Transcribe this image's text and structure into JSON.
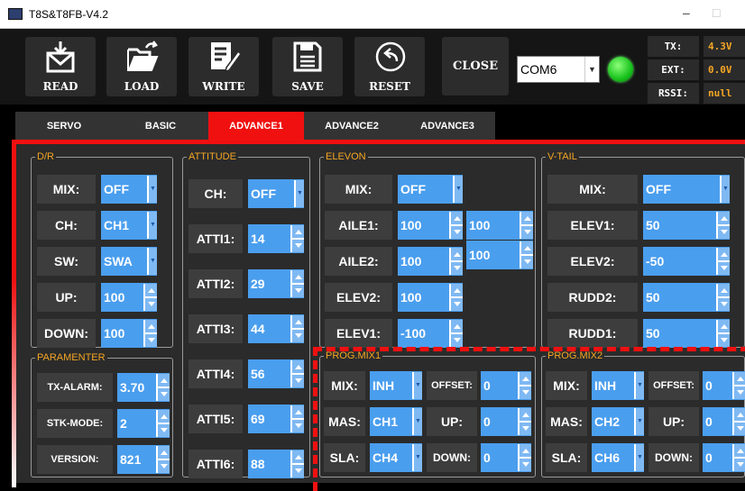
{
  "window": {
    "title": "T8S&T8FB-V4.2",
    "minimize": "–",
    "maximize": "□"
  },
  "toolbar": {
    "read": "READ",
    "load": "LOAD",
    "write": "WRITE",
    "save": "SAVE",
    "reset": "RESET",
    "close": "CLOSE",
    "port": "COM6",
    "connected_color": "#18c21c"
  },
  "status": {
    "tx_label": "TX:",
    "tx_value": "4.3V",
    "ext_label": "EXT:",
    "ext_value": "0.0V",
    "rssi_label": "RSSI:",
    "rssi_value": "null"
  },
  "tabs": [
    "SERVO",
    "BASIC",
    "ADVANCE1",
    "ADVANCE2",
    "ADVANCE3"
  ],
  "dr": {
    "title": "D/R",
    "mix_l": "MIX:",
    "mix": "OFF",
    "ch_l": "CH:",
    "ch": "CH1",
    "sw_l": "SW:",
    "sw": "SWA",
    "up_l": "UP:",
    "up": "100",
    "down_l": "DOWN:",
    "down": "100"
  },
  "param": {
    "title": "PARAMENTER",
    "txalarm_l": "TX-ALARM:",
    "txalarm": "3.70",
    "stk_l": "STK-MODE:",
    "stk": "2",
    "ver_l": "VERSION:",
    "ver": "821"
  },
  "atti": {
    "title": "ATTITUDE",
    "ch_l": "CH:",
    "ch": "OFF",
    "a1_l": "ATTI1:",
    "a1": "14",
    "a2_l": "ATTI2:",
    "a2": "29",
    "a3_l": "ATTI3:",
    "a3": "44",
    "a4_l": "ATTI4:",
    "a4": "56",
    "a5_l": "ATTI5:",
    "a5": "69",
    "a6_l": "ATTI6:",
    "a6": "88"
  },
  "elevon": {
    "title": "ELEVON",
    "mix_l": "MIX:",
    "mix": "OFF",
    "aile1_l": "AILE1:",
    "aile1": "100",
    "aile1b": "100",
    "aile2_l": "AILE2:",
    "aile2": "100",
    "aile2b": "100",
    "elev2_l": "ELEV2:",
    "elev2": "100",
    "elev1_l": "ELEV1:",
    "elev1": "-100"
  },
  "vtail": {
    "title": "V-TAIL",
    "mix_l": "MIX:",
    "mix": "OFF",
    "elev1_l": "ELEV1:",
    "elev1": "50",
    "elev2_l": "ELEV2:",
    "elev2": "-50",
    "rudd2_l": "RUDD2:",
    "rudd2": "50",
    "rudd1_l": "RUDD1:",
    "rudd1": "50"
  },
  "pm1": {
    "title": "PROG.MIX1",
    "mix_l": "MIX:",
    "mix": "INH",
    "off_l": "OFFSET:",
    "off": "0",
    "mas_l": "MAS:",
    "mas": "CH1",
    "up_l": "UP:",
    "up": "0",
    "sla_l": "SLA:",
    "sla": "CH4",
    "down_l": "DOWN:",
    "down": "0"
  },
  "pm2": {
    "title": "PROG.MIX2",
    "mix_l": "MIX:",
    "mix": "INH",
    "off_l": "OFFSET:",
    "off": "0",
    "mas_l": "MAS:",
    "mas": "CH2",
    "up_l": "UP:",
    "up": "0",
    "sla_l": "SLA:",
    "sla": "CH6",
    "down_l": "DOWN:",
    "down": "0"
  }
}
